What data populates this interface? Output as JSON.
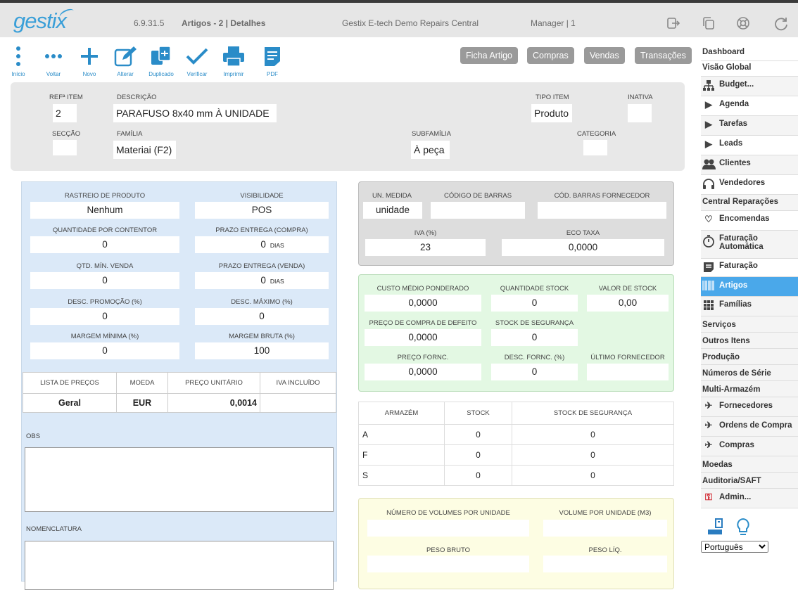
{
  "header": {
    "logo": "gestix",
    "version": "6.9.31.5",
    "page": "Artigos - 2 | Detalhes",
    "company": "Gestix E-tech Demo Repairs Central",
    "user": "Manager | 1"
  },
  "toolbar": {
    "inicio": "Início",
    "voltar": "Voltar",
    "novo": "Novo",
    "alterar": "Alterar",
    "duplicado": "Duplicado",
    "verificar": "Verificar",
    "imprimir": "Imprimir",
    "pdf": "PDF",
    "ficha_artigo": "Ficha Artigo",
    "compras": "Compras",
    "vendas": "Vendas",
    "transacoes": "Transações",
    "accent": "#2a8cc8"
  },
  "item": {
    "ref_label": "REFª ITEM",
    "ref": "2",
    "desc_label": "DESCRIÇÃO",
    "desc": "PARAFUSO 8x40 mm À UNIDADE",
    "tipo_label": "TIPO ITEM",
    "tipo": "Produto",
    "inativa_label": "INATIVA",
    "seccao_label": "SECÇÃO",
    "familia_label": "FAMÍLIA",
    "familia": "Materiai (F2)",
    "subfamilia_label": "SUBFAMÍLIA",
    "subfamilia": "À peça",
    "categoria_label": "CATEGORIA"
  },
  "left": {
    "rastreio_label": "RASTREIO DE PRODUTO",
    "rastreio": "Nenhum",
    "visibilidade_label": "VISIBILIDADE",
    "visibilidade": "POS",
    "qtd_contentor_label": "QUANTIDADE POR CONTENTOR",
    "qtd_contentor": "0",
    "prazo_compra_label": "PRAZO ENTREGA (COMPRA)",
    "prazo_compra": "0",
    "qtd_min_label": "QTD. MÍN. VENDA",
    "qtd_min": "0",
    "prazo_venda_label": "PRAZO ENTREGA (VENDA)",
    "prazo_venda": "0",
    "dias": "DIAS",
    "desc_promo_label": "DESC. PROMOÇÃO (%)",
    "desc_promo": "0",
    "desc_max_label": "DESC. MÁXIMO (%)",
    "desc_max": "0",
    "margem_min_label": "MARGEM MÍNIMA (%)",
    "margem_min": "0",
    "margem_bruta_label": "MARGEM BRUTA (%)",
    "margem_bruta": "100",
    "price_headers": [
      "LISTA DE PREÇOS",
      "MOEDA",
      "PREÇO UNITÁRIO",
      "IVA INCLUÍDO"
    ],
    "price_row": [
      "Geral",
      "EUR",
      "0,0014",
      ""
    ],
    "obs_label": "OBS",
    "nomenclatura_label": "NOMENCLATURA"
  },
  "right": {
    "un_medida_label": "UN. MEDIDA",
    "un_medida": "unidade",
    "cod_barras_label": "CÓDIGO DE BARRAS",
    "cod_barras_forn_label": "CÓD. BARRAS FORNECEDOR",
    "iva_label": "IVA (%)",
    "iva": "23",
    "eco_taxa_label": "ECO TAXA",
    "eco_taxa": "0,0000",
    "custo_medio_label": "CUSTO MÉDIO PONDERADO",
    "custo_medio": "0,0000",
    "qtd_stock_label": "QUANTIDADE STOCK",
    "qtd_stock": "0",
    "valor_stock_label": "VALOR DE STOCK",
    "valor_stock": "0,00",
    "preco_compra_label": "PREÇO DE COMPRA DE DEFEITO",
    "preco_compra": "0,0000",
    "stock_seg_label": "STOCK DE SEGURANÇA",
    "stock_seg": "0",
    "preco_forn_label": "PREÇO FORNC.",
    "preco_forn": "0,0000",
    "desc_forn_label": "DESC. FORNC. (%)",
    "desc_forn": "0",
    "ultimo_forn_label": "ÚLTIMO FORNECEDOR",
    "wh_headers": [
      "ARMAZÉM",
      "STOCK",
      "STOCK DE SEGURANÇA"
    ],
    "wh_rows": [
      [
        "A",
        "0",
        "0"
      ],
      [
        "F",
        "0",
        "0"
      ],
      [
        "S",
        "0",
        "0"
      ]
    ],
    "vol_unid_label": "NÚMERO DE VOLUMES POR UNIDADE",
    "vol_por_unid_label": "VOLUME POR UNIDADE (m3)",
    "peso_bruto_label": "PESO BRUTO",
    "peso_liq_label": "PESO LÍQ."
  },
  "sidebar": {
    "items": [
      {
        "label": "Dashboard",
        "icon": ""
      },
      {
        "label": "Visão Global",
        "icon": ""
      },
      {
        "label": "Budget...",
        "icon": "org-chart-icon"
      },
      {
        "label": "Agenda",
        "icon": "play-icon"
      },
      {
        "label": "Tarefas",
        "icon": "play-icon"
      },
      {
        "label": "Leads",
        "icon": "play-icon"
      },
      {
        "label": "Clientes",
        "icon": "users-icon"
      },
      {
        "label": "Vendedores",
        "icon": "headset-icon"
      },
      {
        "label": "Central Reparações",
        "icon": ""
      },
      {
        "label": "Encomendas",
        "icon": "heart-icon"
      },
      {
        "label": "Faturação Automática",
        "icon": "stopwatch-icon"
      },
      {
        "label": "Faturação",
        "icon": "document-icon"
      },
      {
        "label": "Artigos",
        "icon": "barcode-icon"
      },
      {
        "label": "Famílias",
        "icon": "grid-icon"
      },
      {
        "label": "Serviços",
        "icon": ""
      },
      {
        "label": "Outros Itens",
        "icon": ""
      },
      {
        "label": "Produção",
        "icon": ""
      },
      {
        "label": "Números de Série",
        "icon": ""
      },
      {
        "label": "Multi-Armazém",
        "icon": ""
      },
      {
        "label": "Fornecedores",
        "icon": "hiker-icon"
      },
      {
        "label": "Ordens de Compra",
        "icon": "hiker-icon"
      },
      {
        "label": "Compras",
        "icon": "hiker-icon"
      },
      {
        "label": "Moedas",
        "icon": ""
      },
      {
        "label": "Auditoria/SAFT",
        "icon": ""
      },
      {
        "label": "Admin...",
        "icon": "keys-icon"
      }
    ],
    "language": "Português",
    "active_color": "#4aa8ea"
  }
}
